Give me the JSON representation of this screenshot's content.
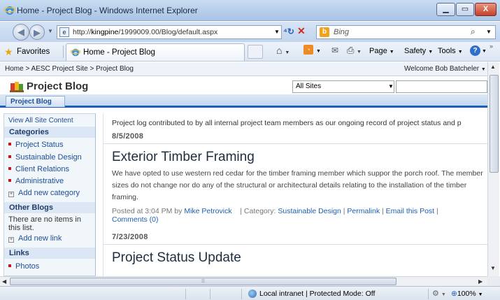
{
  "window": {
    "title": "Home - Project Blog - Windows Internet Explorer",
    "minimize_label": "▭",
    "maximize_label": "▭",
    "close_label": "X"
  },
  "address_bar": {
    "url_prefix": "http://",
    "url_host": "kingpine",
    "url_rest": "/1999009.00/Blog/default.aspx",
    "search_placeholder": "Bing"
  },
  "favorites_bar": {
    "favorites_label": "Favorites",
    "tab_label": "Home - Project Blog"
  },
  "command_bar": {
    "page_label": "Page",
    "safety_label": "Safety",
    "tools_label": "Tools"
  },
  "sharepoint": {
    "breadcrumb": "Home > AESC Project Site > Project Blog",
    "welcome": "Welcome Bob Batcheler",
    "site_title": "Project Blog",
    "search_scope": "All Sites",
    "top_nav_tab": "Project Blog"
  },
  "quick_launch": {
    "view_all": "View All Site Content",
    "categories_heading": "Categories",
    "categories": [
      "Project Status",
      "Sustainable Design",
      "Client Relations",
      "Administrative"
    ],
    "add_category": "Add new category",
    "other_blogs_heading": "Other Blogs",
    "no_items_text": "There are no items in this list.",
    "add_link": "Add new link",
    "links_heading": "Links",
    "links": [
      "Photos"
    ]
  },
  "main": {
    "intro": "Project log contributed to by all internal project team members as our ongoing record of project status and p",
    "posts": [
      {
        "date": "8/5/2008",
        "title": "Exterior Timber Framing",
        "body": "We have opted to use western red cedar for the timber framing member which suppor the porch roof.  The member sizes do not change nor do any of the structural or architectural details relating to the installation of the timber framing.",
        "posted_at": "Posted at 3:04 PM by",
        "author": "Mike Petrovick",
        "category_prefix": "| Category:",
        "category": "Sustainable Design",
        "permalink": "Permalink",
        "email": "Email this Post",
        "comments": "Comments (0)"
      },
      {
        "date": "7/23/2008",
        "title": "Project Status Update"
      }
    ]
  },
  "status_bar": {
    "zone_text": "Local intranet | Protected Mode: Off",
    "zoom": "100%"
  }
}
